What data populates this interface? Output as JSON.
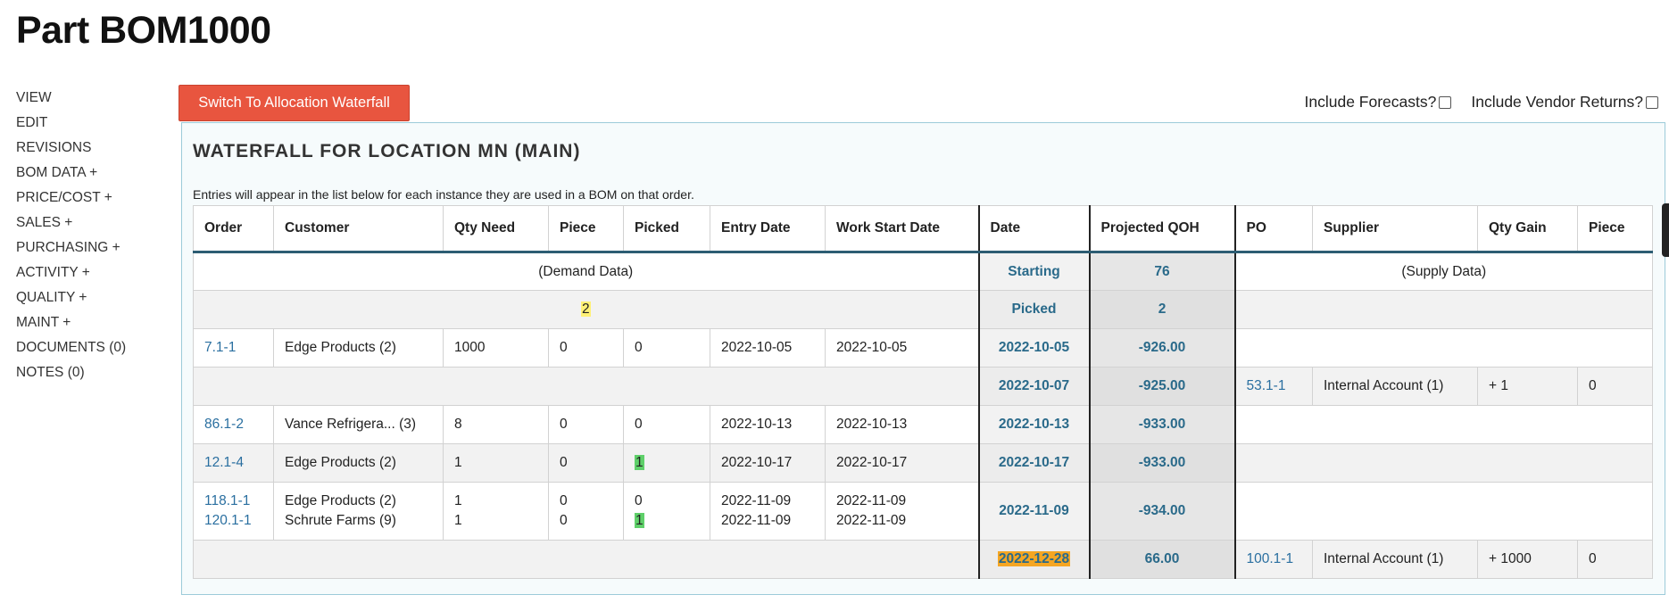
{
  "page": {
    "title": "Part BOM1000"
  },
  "sidebar": {
    "items": [
      "VIEW",
      "EDIT",
      "REVISIONS",
      "BOM DATA +",
      "PRICE/COST +",
      "SALES +",
      "PURCHASING +",
      "ACTIVITY +",
      "QUALITY +",
      "MAINT +",
      "DOCUMENTS (0)",
      "NOTES (0)"
    ]
  },
  "toolbar": {
    "switch_label": "Switch To Allocation Waterfall",
    "include_forecasts_label": "Include Forecasts?",
    "include_forecasts_checked": false,
    "include_vendor_returns_label": "Include Vendor Returns?",
    "include_vendor_returns_checked": false
  },
  "panel": {
    "title": "WATERFALL FOR LOCATION MN (MAIN)",
    "note": "Entries will appear in the list below for each instance they are used in a BOM on that order."
  },
  "table": {
    "headers": [
      "Order",
      "Customer",
      "Qty Need",
      "Piece",
      "Picked",
      "Entry Date",
      "Work Start Date",
      "Date",
      "Projected QOH",
      "PO",
      "Supplier",
      "Qty Gain",
      "Piece"
    ],
    "demand_label": "(Demand Data)",
    "supply_label": "(Supply Data)",
    "starting_label": "Starting",
    "starting_qoh": "76",
    "picked_qty": "2",
    "picked_label": "Picked",
    "picked_qoh": "2",
    "rows": [
      {
        "order": "7.1-1",
        "customer": "Edge Products (2)",
        "qty_need": "1000",
        "piece": "0",
        "picked": "0",
        "entry_date": "2022-10-05",
        "work_start": "2022-10-05",
        "date": "2022-10-05",
        "qoh": "-926.00"
      },
      {
        "date": "2022-10-07",
        "qoh": "-925.00",
        "po": "53.1-1",
        "supplier": "Internal Account (1)",
        "qty_gain": "+ 1",
        "supply_piece": "0"
      },
      {
        "order": "86.1-2",
        "customer": "Vance Refrigera... (3)",
        "qty_need": "8",
        "piece": "0",
        "picked": "0",
        "entry_date": "2022-10-13",
        "work_start": "2022-10-13",
        "date": "2022-10-13",
        "qoh": "-933.00"
      },
      {
        "order": "12.1-4",
        "customer": "Edge Products (2)",
        "qty_need": "1",
        "piece": "0",
        "picked": "1",
        "entry_date": "2022-10-17",
        "work_start": "2022-10-17",
        "date": "2022-10-17",
        "qoh": "-933.00"
      },
      {
        "orders": [
          {
            "order": "118.1-1",
            "customer": "Edge Products (2)",
            "qty_need": "1",
            "piece": "0",
            "picked": "0",
            "entry_date": "2022-11-09",
            "work_start": "2022-11-09"
          },
          {
            "order": "120.1-1",
            "customer": "Schrute Farms (9)",
            "qty_need": "1",
            "piece": "0",
            "picked": "1",
            "entry_date": "2022-11-09",
            "work_start": "2022-11-09"
          }
        ],
        "date": "2022-11-09",
        "qoh": "-934.00"
      },
      {
        "date": "2022-12-28",
        "qoh": "66.00",
        "po": "100.1-1",
        "supplier": "Internal Account (1)",
        "qty_gain": "+ 1000",
        "supply_piece": "0"
      }
    ]
  }
}
